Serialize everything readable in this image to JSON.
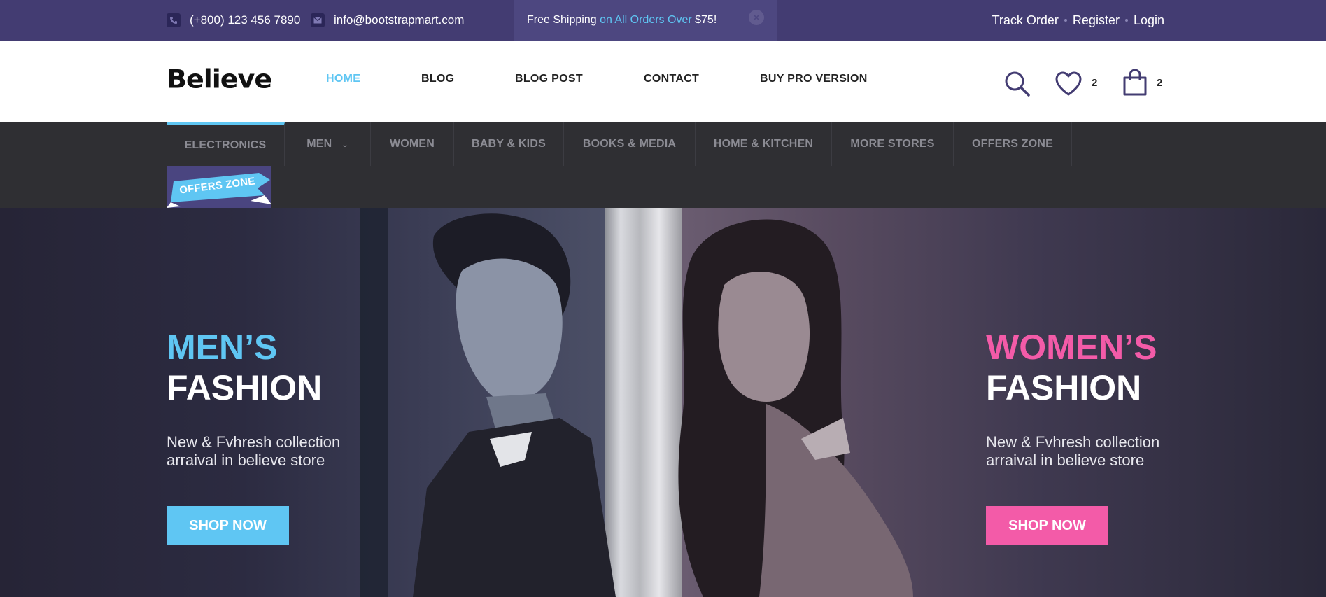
{
  "topbar": {
    "phone": "(+800) 123 456 7890",
    "email": "info@bootstrapmart.com",
    "shipping": {
      "prefix": "Free Shipping ",
      "highlight": "on All Orders Over",
      "amount": " $75!"
    },
    "account": {
      "track_order": "Track Order",
      "register": "Register",
      "login": "Login"
    }
  },
  "header": {
    "logo": "Believe",
    "nav": [
      "HOME",
      "BLOG",
      "BLOG POST",
      "CONTACT",
      "BUY PRO VERSION"
    ],
    "wishlist_count": "2",
    "cart_count": "2"
  },
  "categories": [
    "ELECTRONICS",
    "MEN",
    "WOMEN",
    "BABY & KIDS",
    "BOOKS & MEDIA",
    "HOME & KITCHEN",
    "MORE STORES",
    "OFFERS ZONE"
  ],
  "offers_badge": "OFFERS ZONE",
  "hero": {
    "men": {
      "line1": "MEN’S",
      "line2": "FASHION",
      "sub1": "New & Fvhresh collection",
      "sub2": "arraival in believe store",
      "button": "SHOP NOW"
    },
    "women": {
      "line1": "WOMEN’S",
      "line2": "FASHION",
      "sub1": "New & Fvhresh collection",
      "sub2": "arraival in believe store",
      "button": "SHOP NOW"
    }
  },
  "colors": {
    "topbar": "#433c72",
    "accent_blue": "#5fc6f3",
    "accent_pink": "#f35ba8",
    "catbar": "#2f2f33"
  }
}
